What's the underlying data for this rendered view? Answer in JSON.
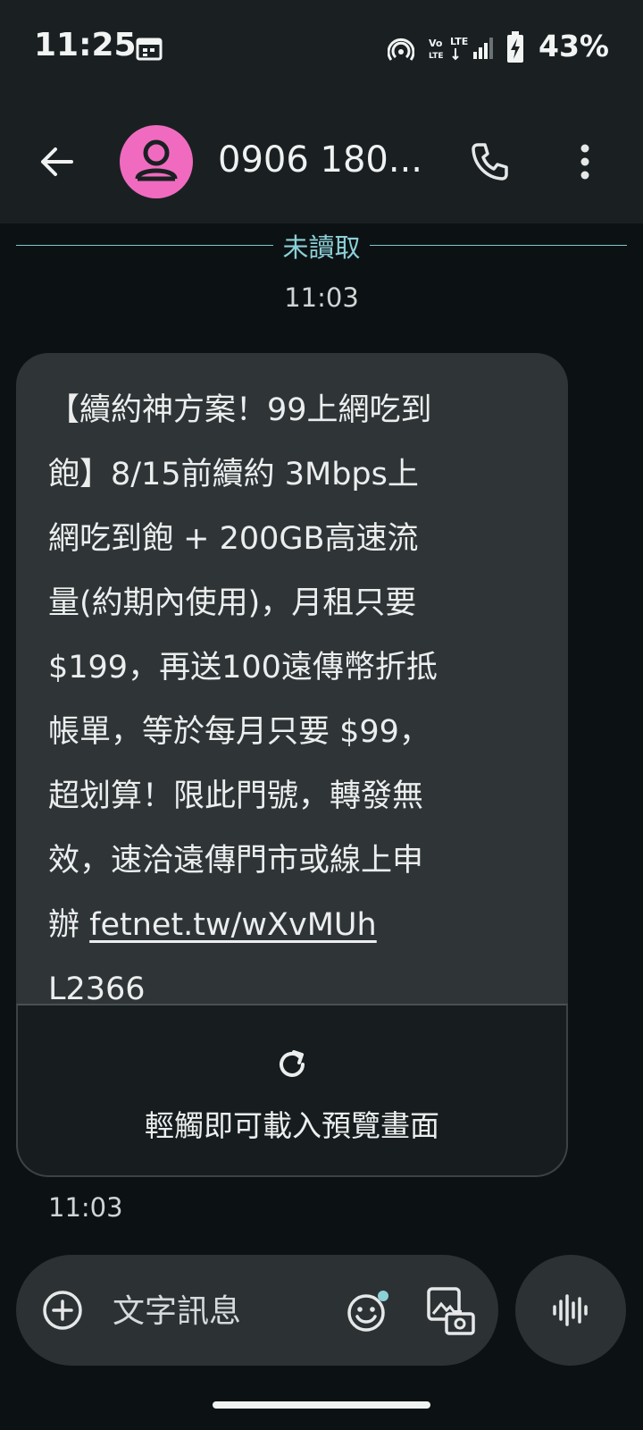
{
  "status_bar": {
    "time": "11:25",
    "battery_percent": "43%",
    "notification_icons": [
      "calendar-icon"
    ],
    "system_icons": [
      "hotspot-icon",
      "volte-icon",
      "lte-icon",
      "signal-icon",
      "battery-charging-icon"
    ]
  },
  "app_bar": {
    "contact_name": "0906 180..."
  },
  "conversation": {
    "unread_label": "未讀取",
    "header_time": "11:03",
    "message": {
      "text_lines": [
        "【續約神方案！99上網吃到",
        "飽】8/15前續約 3Mbps上",
        "網吃到飽 + 200GB高速流",
        "量(約期內使用)，月租只要",
        "$199，再送100遠傳幣折抵",
        "帳單，等於每月只要 $99，",
        "超划算！限此門號，轉發無",
        "效，速洽遠傳門市或線上申"
      ],
      "link_prefix": "辦 ",
      "link": "fetnet.tw/wXvMUh",
      "code": "L2366",
      "preview_label": "輕觸即可載入預覽畫面",
      "time": "11:03"
    }
  },
  "compose": {
    "placeholder": "文字訊息"
  },
  "colors": {
    "background": "#0c1213",
    "app_bar": "#1a2022",
    "bubble": "#2f3537",
    "avatar": "#f06bc0",
    "unread_accent": "#8cd0d8"
  }
}
